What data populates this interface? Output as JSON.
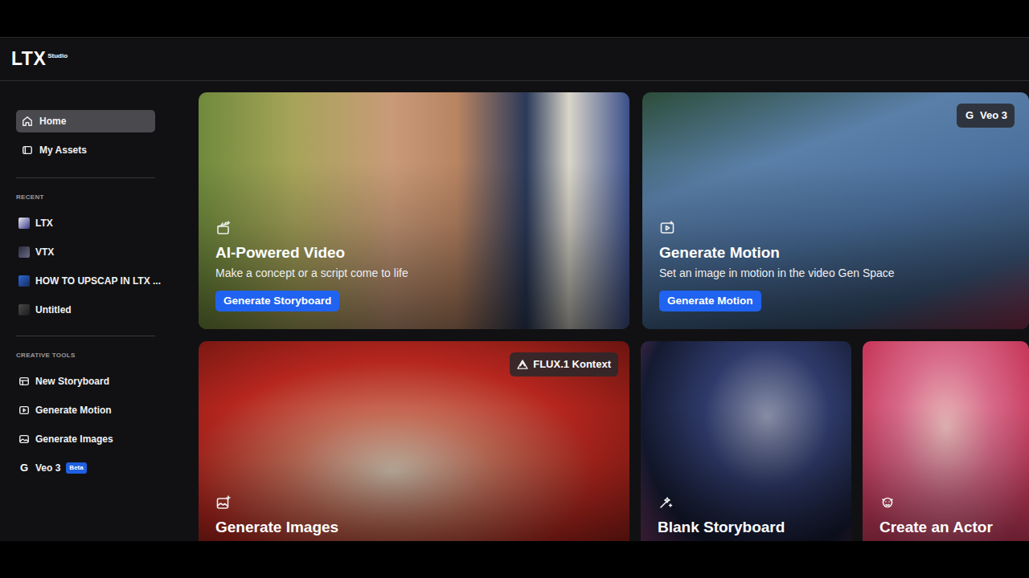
{
  "logo": {
    "mark": "LTX",
    "sub": "Studio"
  },
  "sidebar": {
    "nav": [
      {
        "label": "Home",
        "selected": true
      },
      {
        "label": "My Assets",
        "selected": false
      }
    ],
    "recent_heading": "RECENT",
    "recent": [
      {
        "label": "LTX"
      },
      {
        "label": "VTX"
      },
      {
        "label": "HOW TO UPSCAP IN LTX ..."
      },
      {
        "label": "Untitled"
      }
    ],
    "tools_heading": "CREATIVE TOOLS",
    "tools": [
      {
        "label": "New Storyboard"
      },
      {
        "label": "Generate Motion"
      },
      {
        "label": "Generate Images"
      },
      {
        "label": "Veo 3",
        "icon": "G",
        "badge": "Beta"
      }
    ]
  },
  "cards": [
    {
      "title": "AI-Powered Video",
      "description": "Make a concept or a script come to life",
      "button": "Generate Storyboard"
    },
    {
      "title": "Generate Motion",
      "description": "Set an image in motion in the video Gen Space",
      "button": "Generate Motion",
      "badge": {
        "icon": "G",
        "label": "Veo 3"
      }
    },
    {
      "title": "Generate Images",
      "badge": {
        "label": "FLUX.1 Kontext"
      }
    },
    {
      "title": "Blank Storyboard"
    },
    {
      "title": "Create an Actor"
    }
  ]
}
